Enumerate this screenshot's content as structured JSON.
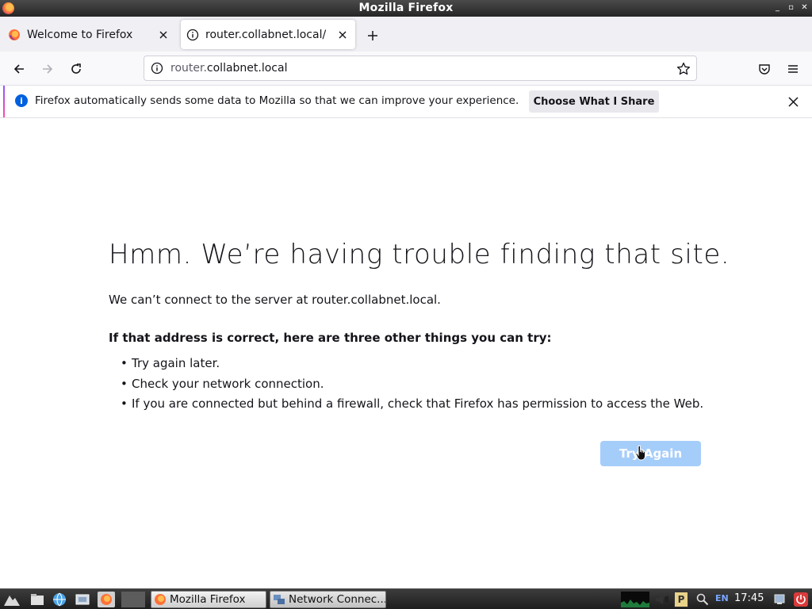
{
  "window": {
    "title": "Mozilla Firefox"
  },
  "tabs": [
    {
      "label": "Welcome to Firefox"
    },
    {
      "label": "router.collabnet.local/"
    }
  ],
  "urlbar": {
    "host_prefix": "router.",
    "host_domain": "collabnet.local"
  },
  "notification": {
    "text": "Firefox automatically sends some data to Mozilla so that we can improve your experience.",
    "button": "Choose What I Share"
  },
  "error": {
    "title": "Hmm. We’re having trouble finding that site.",
    "description": "We can’t connect to the server at router.collabnet.local.",
    "subheading": "If that address is correct, here are three other things you can try:",
    "tips": [
      "Try again later.",
      "Check your network connection.",
      "If you are connected but behind a firewall, check that Firefox has permission to access the Web."
    ],
    "try_again": "Try Again"
  },
  "taskbar": {
    "tasks": [
      {
        "label": "Mozilla Firefox"
      },
      {
        "label": "Network Connec..."
      }
    ],
    "language": "EN",
    "clock": "17:45"
  },
  "colors": {
    "accent": "#0060df",
    "try_again_bg": "#a5cdfa"
  }
}
